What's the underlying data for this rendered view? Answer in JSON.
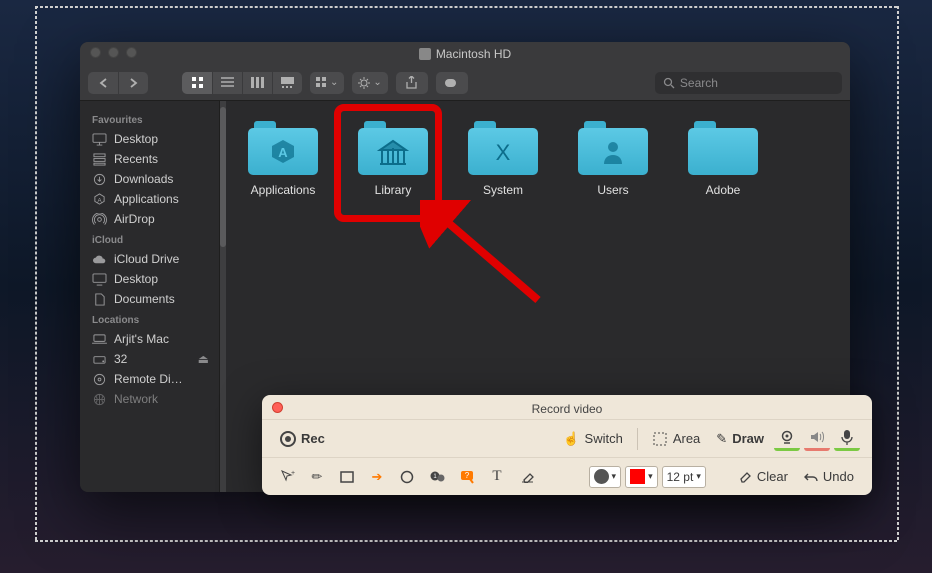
{
  "window": {
    "title": "Macintosh HD",
    "search_placeholder": "Search"
  },
  "sidebar": {
    "sections": [
      {
        "header": "Favourites",
        "items": [
          {
            "label": "Desktop",
            "icon": "desktop"
          },
          {
            "label": "Recents",
            "icon": "recents"
          },
          {
            "label": "Downloads",
            "icon": "downloads"
          },
          {
            "label": "Applications",
            "icon": "apps"
          },
          {
            "label": "AirDrop",
            "icon": "airdrop"
          }
        ]
      },
      {
        "header": "iCloud",
        "items": [
          {
            "label": "iCloud Drive",
            "icon": "cloud"
          },
          {
            "label": "Desktop",
            "icon": "desktop"
          },
          {
            "label": "Documents",
            "icon": "documents"
          }
        ]
      },
      {
        "header": "Locations",
        "items": [
          {
            "label": "Arjit's Mac",
            "icon": "laptop"
          },
          {
            "label": "32",
            "icon": "disk"
          },
          {
            "label": "Remote Di…",
            "icon": "disc"
          },
          {
            "label": "Network",
            "icon": "network"
          }
        ]
      }
    ]
  },
  "folders": [
    {
      "name": "Applications",
      "glyph": "A"
    },
    {
      "name": "Library",
      "glyph": "library",
      "highlighted": true
    },
    {
      "name": "System",
      "glyph": "X"
    },
    {
      "name": "Users",
      "glyph": "user"
    },
    {
      "name": "Adobe",
      "glyph": ""
    }
  ],
  "annotation": {
    "box_target": "Library"
  },
  "panel": {
    "title": "Record video",
    "rec": "Rec",
    "switch": "Switch",
    "area": "Area",
    "draw": "Draw",
    "font_size": "12 pt",
    "clear": "Clear",
    "undo": "Undo",
    "stroke_color": "#555555",
    "fill_color": "#ff0000"
  }
}
